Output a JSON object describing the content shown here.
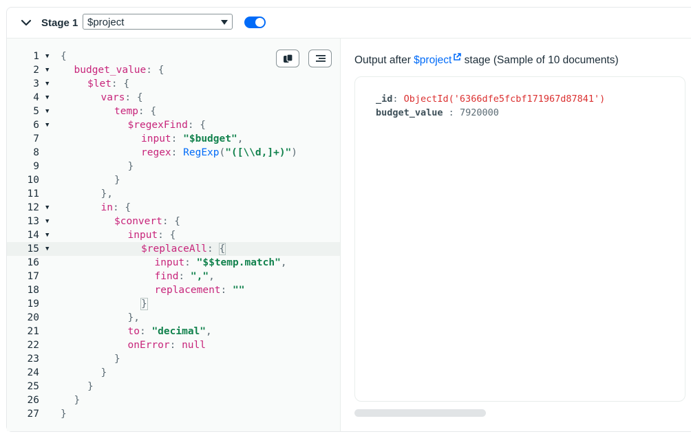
{
  "stage": {
    "title": "Stage 1",
    "operator": "$project",
    "enabled": true
  },
  "editor": {
    "lines": [
      {
        "n": "1",
        "fold": true,
        "indent": 0,
        "tokens": [
          {
            "t": "{",
            "c": "p"
          }
        ]
      },
      {
        "n": "2",
        "fold": true,
        "indent": 1,
        "tokens": [
          {
            "t": "budget_value",
            "c": "k"
          },
          {
            "t": ": {",
            "c": "p"
          }
        ]
      },
      {
        "n": "3",
        "fold": true,
        "indent": 2,
        "tokens": [
          {
            "t": "$let",
            "c": "k"
          },
          {
            "t": ": {",
            "c": "p"
          }
        ]
      },
      {
        "n": "4",
        "fold": true,
        "indent": 3,
        "tokens": [
          {
            "t": "vars",
            "c": "k"
          },
          {
            "t": ": {",
            "c": "p"
          }
        ]
      },
      {
        "n": "5",
        "fold": true,
        "indent": 4,
        "tokens": [
          {
            "t": "temp",
            "c": "k"
          },
          {
            "t": ": {",
            "c": "p"
          }
        ]
      },
      {
        "n": "6",
        "fold": true,
        "indent": 5,
        "tokens": [
          {
            "t": "$regexFind",
            "c": "k"
          },
          {
            "t": ": {",
            "c": "p"
          }
        ]
      },
      {
        "n": "7",
        "fold": false,
        "indent": 6,
        "tokens": [
          {
            "t": "input",
            "c": "k"
          },
          {
            "t": ": ",
            "c": "p"
          },
          {
            "t": "\"$budget\"",
            "c": "s"
          },
          {
            "t": ",",
            "c": "p"
          }
        ]
      },
      {
        "n": "8",
        "fold": false,
        "indent": 6,
        "tokens": [
          {
            "t": "regex",
            "c": "k"
          },
          {
            "t": ": ",
            "c": "p"
          },
          {
            "t": "RegExp",
            "c": "f"
          },
          {
            "t": "(",
            "c": "p"
          },
          {
            "t": "\"([\\\\d,]+)\"",
            "c": "s"
          },
          {
            "t": ")",
            "c": "p"
          }
        ]
      },
      {
        "n": "9",
        "fold": false,
        "indent": 5,
        "tokens": [
          {
            "t": "}",
            "c": "p"
          }
        ]
      },
      {
        "n": "10",
        "fold": false,
        "indent": 4,
        "tokens": [
          {
            "t": "}",
            "c": "p"
          }
        ]
      },
      {
        "n": "11",
        "fold": false,
        "indent": 3,
        "tokens": [
          {
            "t": "},",
            "c": "p"
          }
        ]
      },
      {
        "n": "12",
        "fold": true,
        "indent": 3,
        "tokens": [
          {
            "t": "in",
            "c": "k"
          },
          {
            "t": ": {",
            "c": "p"
          }
        ]
      },
      {
        "n": "13",
        "fold": true,
        "indent": 4,
        "tokens": [
          {
            "t": "$convert",
            "c": "k"
          },
          {
            "t": ": {",
            "c": "p"
          }
        ]
      },
      {
        "n": "14",
        "fold": true,
        "indent": 5,
        "tokens": [
          {
            "t": "input",
            "c": "k"
          },
          {
            "t": ": {",
            "c": "p"
          }
        ]
      },
      {
        "n": "15",
        "fold": true,
        "indent": 6,
        "active": true,
        "tokens": [
          {
            "t": "$replaceAll",
            "c": "k"
          },
          {
            "t": ": ",
            "c": "p"
          },
          {
            "t": "{",
            "c": "p",
            "hl": true
          }
        ]
      },
      {
        "n": "16",
        "fold": false,
        "indent": 7,
        "tokens": [
          {
            "t": "input",
            "c": "k"
          },
          {
            "t": ": ",
            "c": "p"
          },
          {
            "t": "\"$$temp.match\"",
            "c": "s"
          },
          {
            "t": ",",
            "c": "p"
          }
        ]
      },
      {
        "n": "17",
        "fold": false,
        "indent": 7,
        "tokens": [
          {
            "t": "find",
            "c": "k"
          },
          {
            "t": ": ",
            "c": "p"
          },
          {
            "t": "\",\"",
            "c": "s"
          },
          {
            "t": ",",
            "c": "p"
          }
        ]
      },
      {
        "n": "18",
        "fold": false,
        "indent": 7,
        "tokens": [
          {
            "t": "replacement",
            "c": "k"
          },
          {
            "t": ": ",
            "c": "p"
          },
          {
            "t": "\"\"",
            "c": "s"
          }
        ]
      },
      {
        "n": "19",
        "fold": false,
        "indent": 6,
        "tokens": [
          {
            "t": "}",
            "c": "p",
            "hl": true
          }
        ]
      },
      {
        "n": "20",
        "fold": false,
        "indent": 5,
        "tokens": [
          {
            "t": "},",
            "c": "p"
          }
        ]
      },
      {
        "n": "21",
        "fold": false,
        "indent": 5,
        "tokens": [
          {
            "t": "to",
            "c": "k"
          },
          {
            "t": ": ",
            "c": "p"
          },
          {
            "t": "\"decimal\"",
            "c": "s"
          },
          {
            "t": ",",
            "c": "p"
          }
        ]
      },
      {
        "n": "22",
        "fold": false,
        "indent": 5,
        "tokens": [
          {
            "t": "onError",
            "c": "k"
          },
          {
            "t": ": ",
            "c": "p"
          },
          {
            "t": "null",
            "c": "k"
          }
        ]
      },
      {
        "n": "23",
        "fold": false,
        "indent": 4,
        "tokens": [
          {
            "t": "}",
            "c": "p"
          }
        ]
      },
      {
        "n": "24",
        "fold": false,
        "indent": 3,
        "tokens": [
          {
            "t": "}",
            "c": "p"
          }
        ]
      },
      {
        "n": "25",
        "fold": false,
        "indent": 2,
        "tokens": [
          {
            "t": "}",
            "c": "p"
          }
        ]
      },
      {
        "n": "26",
        "fold": false,
        "indent": 1,
        "tokens": [
          {
            "t": "}",
            "c": "p"
          }
        ]
      },
      {
        "n": "27",
        "fold": false,
        "indent": 0,
        "tokens": [
          {
            "t": "}",
            "c": "p"
          }
        ]
      }
    ]
  },
  "output": {
    "prefix": "Output after ",
    "link": "$project",
    "suffix": " stage (Sample of 10 documents)",
    "doc": {
      "id_key": "_id",
      "id_value": "ObjectId('6366dfe5fcbf171967d87841')",
      "budget_key": "budget_value",
      "budget_value": "7920000"
    }
  },
  "colors": {
    "accent": "#016bf8",
    "key": "#c7247a",
    "string": "#12824d",
    "objectid": "#db3030"
  },
  "icons": [
    "chevron-down-icon",
    "copy-icon",
    "format-icon",
    "external-link-icon"
  ]
}
